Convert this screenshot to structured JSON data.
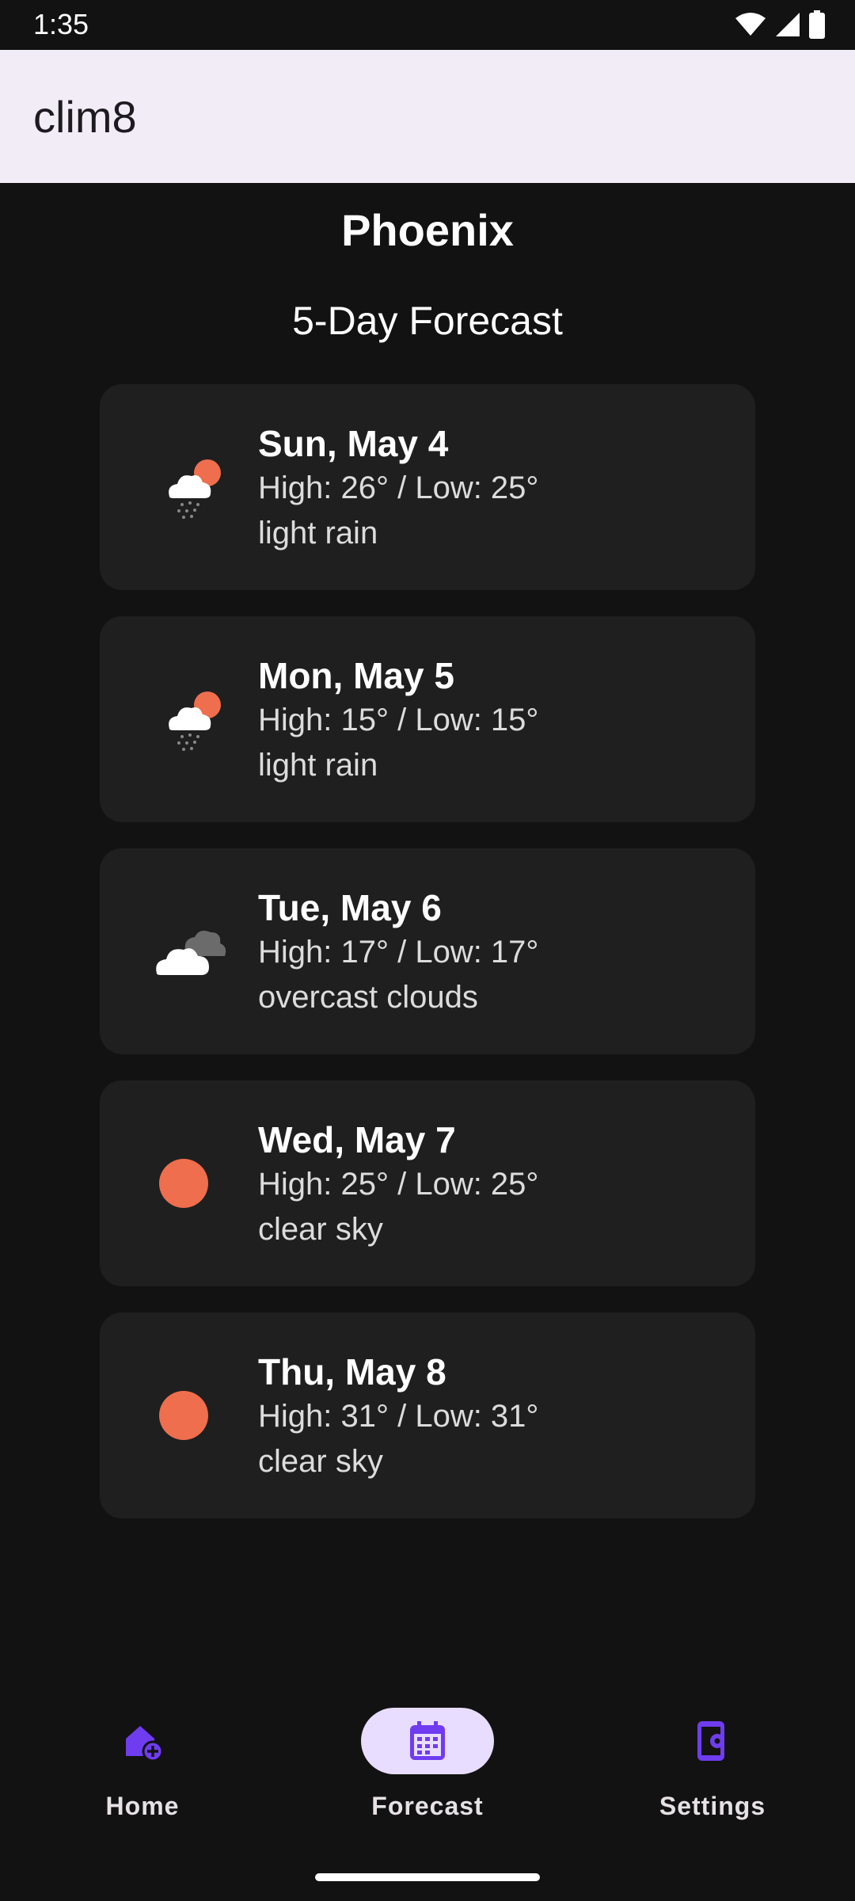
{
  "status_bar": {
    "time": "1:35",
    "icons": [
      "wifi-icon",
      "signal-icon",
      "battery-icon"
    ]
  },
  "app_bar": {
    "title": "clim8"
  },
  "location": {
    "city": "Phoenix"
  },
  "forecast": {
    "title": "5-Day Forecast",
    "days": [
      {
        "date": "Sun, May 4",
        "temps": "High: 26° / Low: 25°",
        "description": "light rain",
        "icon": "light-rain-icon"
      },
      {
        "date": "Mon, May 5",
        "temps": "High: 15° / Low: 15°",
        "description": "light rain",
        "icon": "light-rain-icon"
      },
      {
        "date": "Tue, May 6",
        "temps": "High: 17° / Low: 17°",
        "description": "overcast clouds",
        "icon": "overcast-clouds-icon"
      },
      {
        "date": "Wed, May 7",
        "temps": "High: 25° / Low: 25°",
        "description": "clear sky",
        "icon": "clear-sky-icon"
      },
      {
        "date": "Thu, May 8",
        "temps": "High: 31° / Low: 31°",
        "description": "clear sky",
        "icon": "clear-sky-icon"
      }
    ]
  },
  "bottom_nav": {
    "items": [
      {
        "label": "Home",
        "icon": "home-add-icon",
        "active": false
      },
      {
        "label": "Forecast",
        "icon": "calendar-icon",
        "active": true
      },
      {
        "label": "Settings",
        "icon": "phone-settings-icon",
        "active": false
      }
    ]
  },
  "colors": {
    "background": "#121212",
    "app_bar": "#f2ecf7",
    "card": "#1f1f1f",
    "accent": "#6f3cf0",
    "sun": "#ee6e4d",
    "nav_active_pill": "#e9ddff"
  }
}
